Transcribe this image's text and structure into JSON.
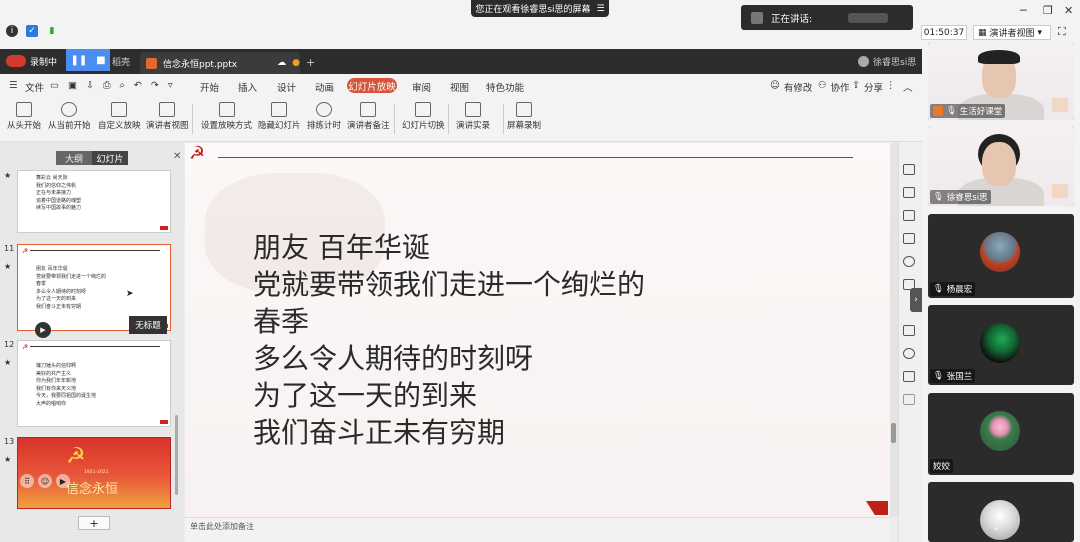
{
  "meeting": {
    "watching_banner": "您正在观看徐睿思si思的屏幕",
    "speaking_label": "正在讲话:",
    "timer": "01:50:37",
    "presenter_view_label": "演讲者视图"
  },
  "app": {
    "recording_label": "录制中",
    "tab_daoke": "稻壳",
    "doc_tab": "信念永恒ppt.pptx",
    "user": "徐睿思si思",
    "menu": [
      "文件",
      "开始",
      "插入",
      "设计",
      "动画",
      "幻灯片放映",
      "审阅",
      "视图",
      "特色功能"
    ],
    "active_menu": "幻灯片放映",
    "right_tools": [
      "有修改",
      "协作",
      "分享"
    ],
    "ribbon": [
      "从头开始",
      "从当前开始",
      "自定义放映",
      "演讲者视图",
      "设置放映方式",
      "隐藏幻灯片",
      "排练计时",
      "演讲者备注",
      "幻灯片切换",
      "演讲实录",
      "屏幕录制"
    ]
  },
  "sidebar": {
    "tab_outline": "大纲",
    "tab_slides": "幻灯片",
    "tooltip": "无标题",
    "add_label": "+",
    "slides": [
      {
        "num": "",
        "lines": [
          "舞彩云 尚天际",
          "我们的信仰之伟帆",
          "正在与未来接力",
          "追着中国道路的魂塑",
          "续写中国故事的魅力"
        ]
      },
      {
        "num": "11",
        "lines": [
          "朋友 百年华诞",
          "党就要带领我们走进一个绚烂的",
          "春季",
          "多么令人期待的时刻呀",
          "为了这一天的到来",
          "我们奋斗正未有穷期"
        ]
      },
      {
        "num": "12",
        "lines": [
          "镰刀锤头的信仰啊",
          "美好的共产主义",
          "你为我们年年新地",
          "我们有你来天义地",
          "今天，我要同祖国的诞生地",
          "大声的唱响你"
        ]
      },
      {
        "num": "13",
        "title": "信念永恒",
        "sub": "1921-2021"
      }
    ]
  },
  "slide": {
    "lines": [
      "朋友 百年华诞",
      "党就要带领我们走进一个绚烂的",
      "春季",
      "多么令人期待的时刻呀",
      "为了这一天的到来",
      "我们奋斗正未有穷期"
    ],
    "notes_placeholder": "单击此处添加备注"
  },
  "participants": [
    {
      "name": "生活好课堂",
      "kind": "video-man"
    },
    {
      "name": "徐睿思si思",
      "kind": "video-woman"
    },
    {
      "name": "杨晨宏",
      "kind": "avatar-car"
    },
    {
      "name": "张国兰",
      "kind": "avatar-dark"
    },
    {
      "name": "姣姣",
      "kind": "avatar-lotus"
    },
    {
      "name": "",
      "kind": "avatar-other"
    }
  ],
  "colors": {
    "accent": "#d4553a",
    "record_blue": "#4a8df3",
    "party_red": "#c0201a"
  }
}
